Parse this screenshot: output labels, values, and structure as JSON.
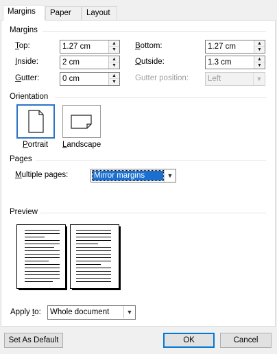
{
  "tabs": [
    {
      "label": "Margins",
      "active": true
    },
    {
      "label": "Paper",
      "active": false
    },
    {
      "label": "Layout",
      "active": false
    }
  ],
  "margins": {
    "title": "Margins",
    "top": {
      "label_u": "T",
      "label_rest": "op:",
      "value": "1.27 cm"
    },
    "bottom": {
      "label_u": "B",
      "label_rest": "ottom:",
      "value": "1.27 cm"
    },
    "inside": {
      "label_u": "I",
      "label_rest": "nside:",
      "value": "2 cm"
    },
    "outside": {
      "label_u": "O",
      "label_rest": "utside:",
      "value": "1.3 cm"
    },
    "gutter": {
      "label_u": "G",
      "label_rest": "utter:",
      "value": "0 cm"
    },
    "gutter_position": {
      "label": "Gutter position:",
      "value": "Left"
    }
  },
  "orientation": {
    "title": "Orientation",
    "portrait": {
      "label_u": "P",
      "label_rest": "ortrait",
      "selected": true
    },
    "landscape": {
      "label_u": "L",
      "label_rest": "andscape",
      "selected": false
    }
  },
  "pages": {
    "title": "Pages",
    "multiple_pages": {
      "label_u": "M",
      "label_rest": "ultiple pages:",
      "value": "Mirror margins"
    }
  },
  "preview": {
    "title": "Preview",
    "apply_to": {
      "label_pre": "Apply ",
      "label_u": "t",
      "label_rest": "o:",
      "value": "Whole document"
    }
  },
  "buttons": {
    "set_default": "Set As Default",
    "ok": "OK",
    "cancel": "Cancel"
  },
  "colors": {
    "accent": "#0078d7",
    "selection": "#1a6fd0"
  }
}
